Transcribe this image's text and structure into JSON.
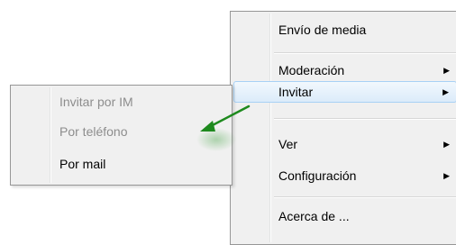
{
  "main_menu": {
    "items": [
      {
        "label": "Envío de media",
        "has_submenu": false
      },
      {
        "label": "Moderación",
        "has_submenu": true
      },
      {
        "label": "Invitar",
        "has_submenu": true,
        "highlighted": true
      },
      {
        "label": "Ver",
        "has_submenu": true
      },
      {
        "label": "Configuración",
        "has_submenu": true
      },
      {
        "label": "Acerca de ...",
        "has_submenu": false
      }
    ],
    "submenu_arrow": "▶"
  },
  "invite_submenu": {
    "items": [
      {
        "label": "Invitar por IM",
        "enabled": false
      },
      {
        "label": "Por teléfono",
        "enabled": false
      },
      {
        "label": "Por mail",
        "enabled": true
      }
    ]
  },
  "annotation": {
    "arrow_color": "#1e8a1e"
  }
}
